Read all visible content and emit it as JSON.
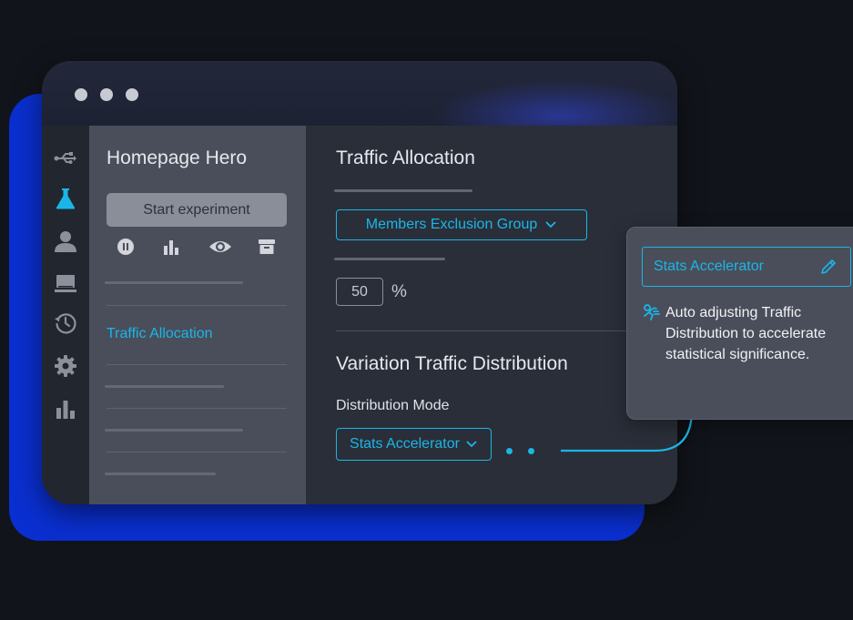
{
  "window": {
    "controls": [
      "dot",
      "dot",
      "dot"
    ]
  },
  "rail": {
    "icons": [
      "usb-icon",
      "flask-icon",
      "user-icon",
      "monitor-icon",
      "history-icon",
      "gear-icon",
      "bar-chart-icon"
    ]
  },
  "sidebar": {
    "title": "Homepage Hero",
    "start_button_label": "Start experiment",
    "tool_icons": [
      "pause-icon",
      "bar-chart-icon",
      "eye-icon",
      "archive-icon"
    ],
    "active_item_label": "Traffic Allocation"
  },
  "main": {
    "traffic_title": "Traffic Allocation",
    "exclusion_group_label": "Members Exclusion Group",
    "percent_value": "50",
    "percent_unit": "%",
    "variation_title": "Variation Traffic Distribution",
    "distribution_mode_label": "Distribution Mode",
    "distribution_mode_value": "Stats Accelerator"
  },
  "popover": {
    "field_value": "Stats Accelerator",
    "description": "Auto adjusting Traffic Distribution to accelerate statistical significance."
  },
  "colors": {
    "accent": "#1ab6e8",
    "brand_blue": "#0a2fd0",
    "background": "#11141a",
    "sidebar": "#4a4e5a",
    "panel": "#2a2e38"
  }
}
